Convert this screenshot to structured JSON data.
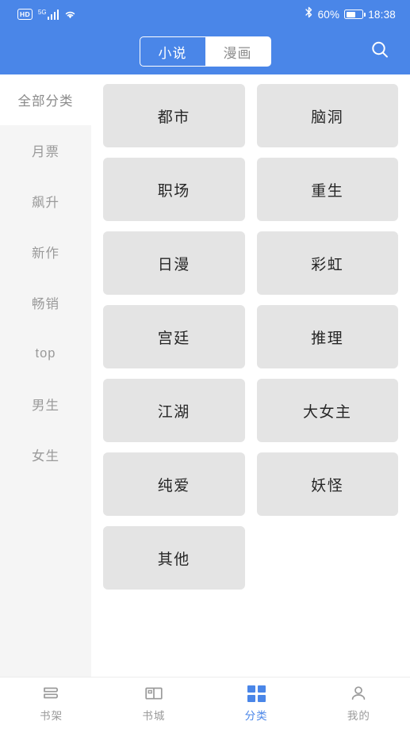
{
  "statusbar": {
    "hd_badge": "HD",
    "network_gen": "5G",
    "signal_icon": "signal-bars-icon",
    "wifi_icon": "wifi-icon",
    "bluetooth_icon": "bluetooth-icon",
    "battery_percent": "60%",
    "battery_level": 60,
    "battery_icon": "battery-icon",
    "time": "18:38"
  },
  "header": {
    "segments": [
      {
        "label": "小说",
        "active": true
      },
      {
        "label": "漫画",
        "active": false
      }
    ],
    "search_icon": "search-icon",
    "accent_color": "#4a86e8"
  },
  "sidebar": {
    "items": [
      {
        "label": "全部分类",
        "active": true
      },
      {
        "label": "月票",
        "active": false
      },
      {
        "label": "飙升",
        "active": false
      },
      {
        "label": "新作",
        "active": false
      },
      {
        "label": "畅销",
        "active": false
      },
      {
        "label": "top",
        "active": false
      },
      {
        "label": "男生",
        "active": false
      },
      {
        "label": "女生",
        "active": false
      }
    ]
  },
  "categories": [
    {
      "label": "都市"
    },
    {
      "label": "脑洞"
    },
    {
      "label": "职场"
    },
    {
      "label": "重生"
    },
    {
      "label": "日漫"
    },
    {
      "label": "彩虹"
    },
    {
      "label": "宫廷"
    },
    {
      "label": "推理"
    },
    {
      "label": "江湖"
    },
    {
      "label": "大女主"
    },
    {
      "label": "纯爱"
    },
    {
      "label": "妖怪"
    },
    {
      "label": "其他"
    }
  ],
  "bottom_nav": {
    "items": [
      {
        "label": "书架",
        "icon": "bookshelf-icon",
        "active": false
      },
      {
        "label": "书城",
        "icon": "open-book-icon",
        "active": false
      },
      {
        "label": "分类",
        "icon": "grid-categories-icon",
        "active": true
      },
      {
        "label": "我的",
        "icon": "person-icon",
        "active": false
      }
    ]
  }
}
